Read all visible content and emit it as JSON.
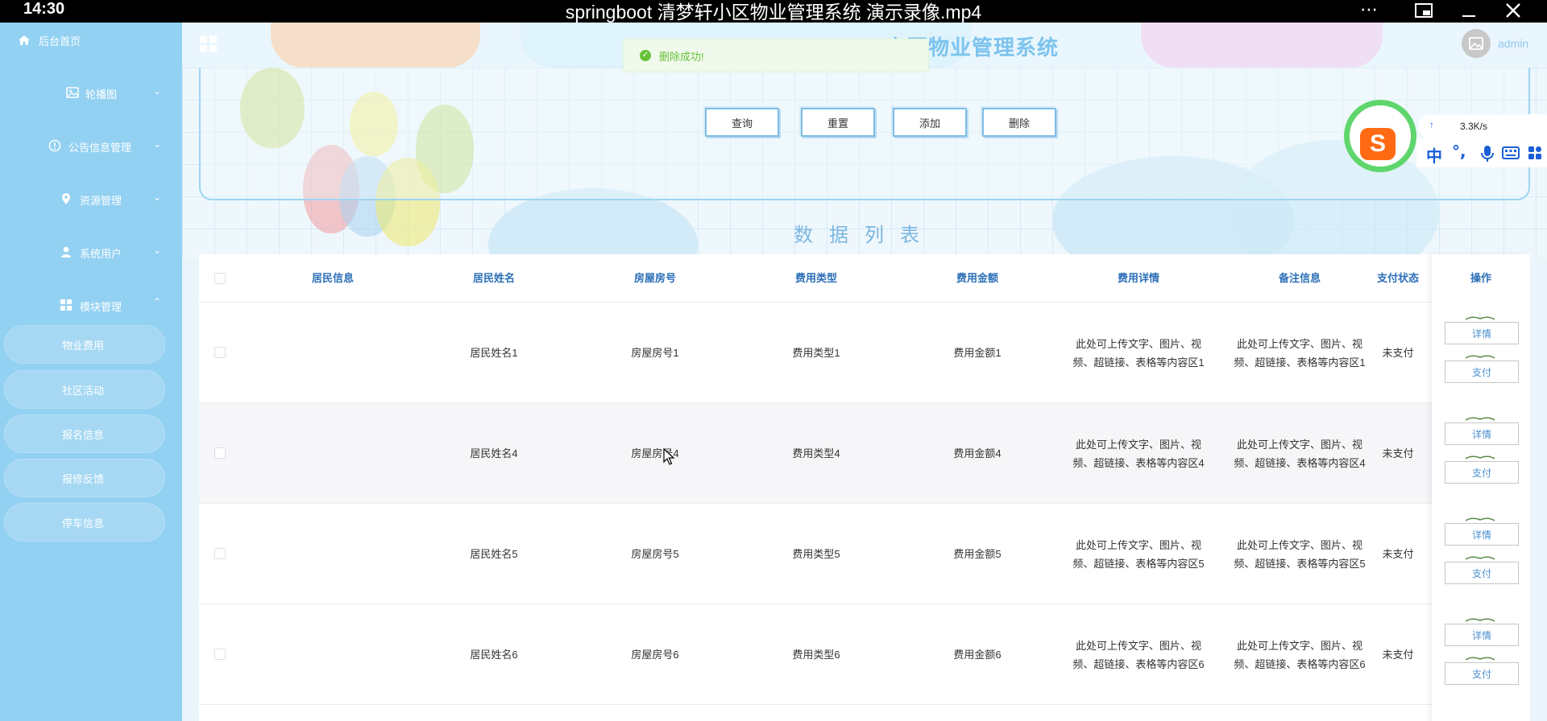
{
  "player": {
    "time": "14:30",
    "title": "springboot 清梦轩小区物业管理系统 演示录像.mp4",
    "controls": [
      "more-icon",
      "pip-icon",
      "minimize-icon",
      "close-icon"
    ]
  },
  "header": {
    "title": "小区物业管理系统",
    "user": "admin"
  },
  "toast": {
    "message": "删除成功!"
  },
  "sidebar": {
    "home": "后台首页",
    "menus": [
      {
        "label": "轮播图",
        "icon": "image-icon"
      },
      {
        "label": "公告信息管理",
        "icon": "info-icon"
      },
      {
        "label": "资源管理",
        "icon": "location-icon"
      },
      {
        "label": "系统用户",
        "icon": "user-icon"
      },
      {
        "label": "模块管理",
        "icon": "grid-icon"
      }
    ],
    "submenu": [
      "物业费用",
      "社区活动",
      "报名信息",
      "报修反馈",
      "停车信息"
    ]
  },
  "search": {
    "buttons": [
      "查询",
      "重置",
      "添加",
      "删除"
    ]
  },
  "list_title": "数据列表",
  "ime": {
    "speed": "3.3K/s",
    "lang": "中",
    "punct": "°,"
  },
  "table": {
    "columns": [
      "居民信息",
      "居民姓名",
      "房屋房号",
      "费用类型",
      "费用金额",
      "费用详情",
      "备注信息",
      "支付状态",
      "操作"
    ],
    "rows": [
      {
        "name": "居民姓名1",
        "room": "房屋房号1",
        "type": "费用类型1",
        "amount": "费用金额1",
        "detail": [
          "此处可上传文字、图片、视",
          "频、超链接、表格等内容区1"
        ],
        "remark": [
          "此处可上传文字、图片、视",
          "频、超链接、表格等内容区1"
        ],
        "status": "未支付"
      },
      {
        "name": "居民姓名4",
        "room": "房屋房号4",
        "type": "费用类型4",
        "amount": "费用金额4",
        "detail": [
          "此处可上传文字、图片、视",
          "频、超链接、表格等内容区4"
        ],
        "remark": [
          "此处可上传文字、图片、视",
          "频、超链接、表格等内容区4"
        ],
        "status": "未支付"
      },
      {
        "name": "居民姓名5",
        "room": "房屋房号5",
        "type": "费用类型5",
        "amount": "费用金额5",
        "detail": [
          "此处可上传文字、图片、视",
          "频、超链接、表格等内容区5"
        ],
        "remark": [
          "此处可上传文字、图片、视",
          "频、超链接、表格等内容区5"
        ],
        "status": "未支付"
      },
      {
        "name": "居民姓名6",
        "room": "房屋房号6",
        "type": "费用类型6",
        "amount": "费用金额6",
        "detail": [
          "此处可上传文字、图片、视",
          "频、超链接、表格等内容区6"
        ],
        "remark": [
          "此处可上传文字、图片、视",
          "频、超链接、表格等内容区6"
        ],
        "status": "未支付"
      }
    ],
    "actions": [
      "详情",
      "支付"
    ]
  },
  "colors": {
    "sidebar": "#93d1f2",
    "accent": "#2c6fb7",
    "success": "#67c23a"
  }
}
